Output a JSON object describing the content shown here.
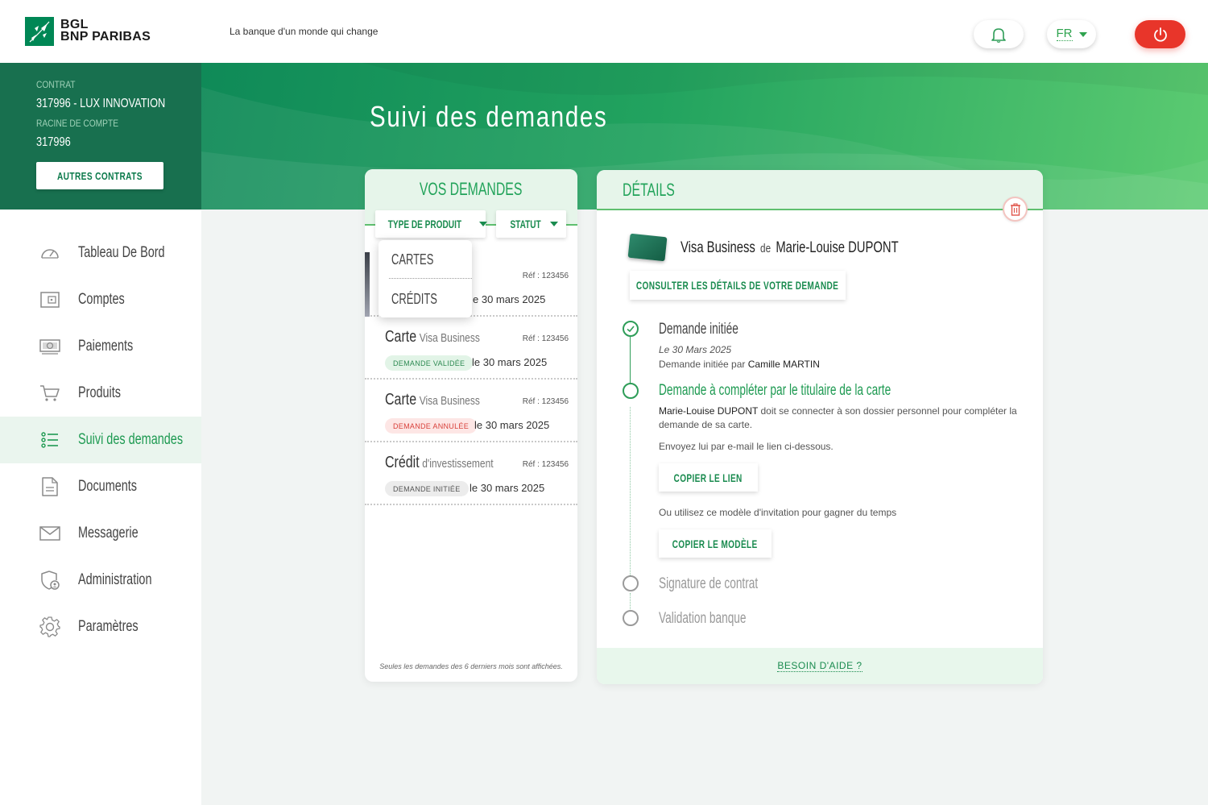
{
  "brand": {
    "line1": "BGL",
    "line2": "BNP PARIBAS",
    "tagline": "La banque d'un monde qui change",
    "color": "#008755"
  },
  "topbar": {
    "notifications_icon": "bell-icon",
    "language": "FR",
    "power_icon": "power-icon",
    "power_color": "#e8352a"
  },
  "contract": {
    "contract_label": "CONTRAT",
    "contract_value": "317996 - LUX INNOVATION",
    "root_label": "RACINE DE COMPTE",
    "root_value": "317996",
    "other_button": "AUTRES CONTRATS"
  },
  "page": {
    "title": "Suivi des demandes"
  },
  "sidebar": {
    "items": [
      {
        "label": "Tableau De Bord",
        "icon": "dashboard-icon"
      },
      {
        "label": "Comptes",
        "icon": "wallet-icon"
      },
      {
        "label": "Paiements",
        "icon": "cash-icon"
      },
      {
        "label": "Produits",
        "icon": "cart-icon"
      },
      {
        "label": "Suivi des demandes",
        "icon": "list-icon",
        "active": true
      },
      {
        "label": "Documents",
        "icon": "document-icon"
      },
      {
        "label": "Messagerie",
        "icon": "mail-icon"
      },
      {
        "label": "Administration",
        "icon": "admin-shield-icon"
      },
      {
        "label": "Paramètres",
        "icon": "gear-icon"
      }
    ]
  },
  "requests": {
    "title": "VOS DEMANDES",
    "filter_type": "TYPE DE PRODUIT",
    "filter_status": "STATUT",
    "dropdown": [
      "CARTES",
      "CRÉDITS"
    ],
    "first_item": {
      "ref": "Réf : 123456",
      "date_partial": "e 30 mars 2025"
    },
    "items": [
      {
        "product": "Carte",
        "detail": "Visa Business",
        "ref": "Réf : 123456",
        "status": "DEMANDE VALIDÉE",
        "date": "le 30 mars 2025"
      },
      {
        "product": "Carte",
        "detail": "Visa Business",
        "ref": "Réf : 123456",
        "status": "DEMANDE ANNULÉE",
        "date": "le 30 mars 2025"
      },
      {
        "product": "Crédit",
        "detail": "d'investissement",
        "ref": "Réf : 123456",
        "status": "DEMANDE INITIÉE",
        "date": "le 30 mars 2025"
      }
    ],
    "footnote": "Seules les demandes des 6 derniers mois sont affichées."
  },
  "details": {
    "title": "DÉTAILS",
    "product": "Visa Business",
    "of": "de",
    "holder": "Marie-Louise DUPONT",
    "consult_button": "CONSULTER LES DÉTAILS DE VOTRE DEMANDE",
    "steps": {
      "s1_title": "Demande initiée",
      "s1_date": "Le 30 Mars 2025",
      "s1_by_prefix": "Demande initiée par",
      "s1_by_name": "Camille MARTIN",
      "s2_title": "Demande à compléter par le titulaire de la carte",
      "s2_holder": "Marie-Louise DUPONT",
      "s2_text": "doit se connecter à son dossier personnel pour compléter la demande de sa carte.",
      "s2_send": "Envoyez lui par e-mail le lien ci-dessous.",
      "copy_link": "COPIER LE LIEN",
      "s2_or": "Ou utilisez ce modèle d'invitation pour gagner du temps",
      "copy_model": "COPIER LE MODÈLE",
      "s3_title": "Signature de contrat",
      "s4_title": "Validation banque"
    },
    "help": "BESOIN D'AIDE ?"
  }
}
